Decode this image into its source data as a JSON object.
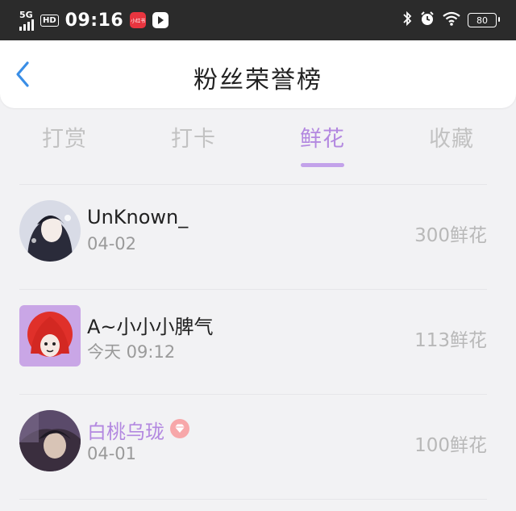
{
  "status_bar": {
    "network": "5G",
    "hd": "HD",
    "time": "09:16",
    "app_badge": "小红书",
    "battery": "80"
  },
  "header": {
    "title": "粉丝荣誉榜"
  },
  "tabs": [
    {
      "label": "打赏",
      "active": false
    },
    {
      "label": "打卡",
      "active": false
    },
    {
      "label": "鲜花",
      "active": true
    },
    {
      "label": "收藏",
      "active": false
    }
  ],
  "fans": [
    {
      "name": "UnKnown_",
      "date": "04-02",
      "amount": "300鲜花",
      "vip": false
    },
    {
      "name": "A~小小小脾气",
      "date": "今天 09:12",
      "amount": "113鲜花",
      "vip": false
    },
    {
      "name": "白桃乌珑",
      "date": "04-01",
      "amount": "100鲜花",
      "vip": true
    }
  ],
  "colors": {
    "accent": "#b388e0",
    "status_bar": "#2b2b2b",
    "background": "#f2f2f4"
  }
}
